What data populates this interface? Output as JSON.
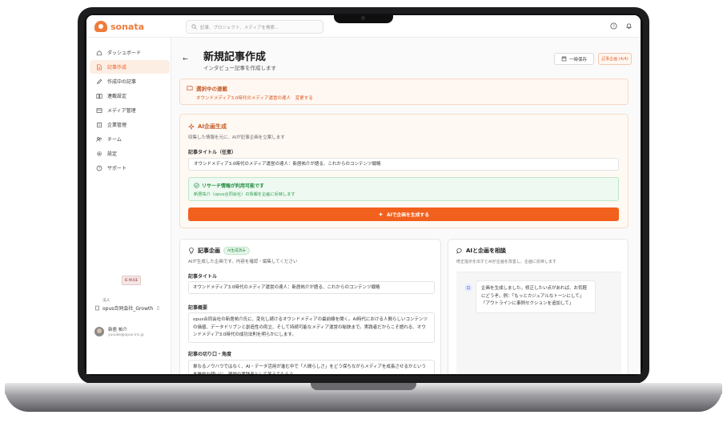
{
  "app": {
    "brand": "sonata"
  },
  "search": {
    "placeholder": "記事、プロジェクト、メディアを検索..."
  },
  "sidebar": {
    "items": [
      {
        "label": "ダッシュボード",
        "icon": "home-icon",
        "active": false
      },
      {
        "label": "記事作成",
        "icon": "document-icon",
        "active": true
      },
      {
        "label": "作成中の記事",
        "icon": "pencil-icon",
        "active": false
      },
      {
        "label": "連載設定",
        "icon": "book-icon",
        "active": false
      },
      {
        "label": "メディア管理",
        "icon": "media-icon",
        "active": false
      },
      {
        "label": "企業管理",
        "icon": "building-icon",
        "active": false
      },
      {
        "label": "チーム",
        "icon": "team-icon",
        "active": false
      },
      {
        "label": "設定",
        "icon": "gear-icon",
        "active": false
      },
      {
        "label": "サポート",
        "icon": "help-icon",
        "active": false
      }
    ],
    "promo_label": "IE MUSE",
    "org_label": "法人",
    "org_name": "opus合同会社_Growth",
    "user_name": "新居 祐介",
    "user_email": "yusuke@opus-inc.jp"
  },
  "header": {
    "title": "新規記事作成",
    "subtitle": "インタビュー記事を作成します",
    "save_label": "一時保存",
    "step_label": "記事企画 (4/4)"
  },
  "selected": {
    "title": "選択中の連載",
    "value": "オウンドメディア3.0時代のメディア運営の達人",
    "change_label": "変更する"
  },
  "ai_generate": {
    "title": "AI企画生成",
    "description": "収集した情報を元に、AIが記事企画を立案します",
    "title_label": "記事タイトル（任意）",
    "title_value": "オウンドメディア3.0時代のメディア運営の達人：新居祐介が語る、これからのコンテンツ戦略",
    "research_title": "リサーチ情報が利用可能です",
    "research_desc": "新居祐介（opus合同会社）の情報を企画に反映します",
    "button_label": "AIで企画を生成する"
  },
  "plan": {
    "title": "記事企画",
    "badge": "AI生成済み",
    "description": "AIが生成した企画です。内容を確認・編集してください",
    "title_label": "記事タイトル",
    "title_value": "オウンドメディア3.0時代のメディア運営の達人：新居祐介が語る、これからのコンテンツ戦略",
    "summary_label": "記事概要",
    "summary_value": "opus合同会社の新居祐介氏に、変化し続けるオウンドメディアの最前線を聞く。AI時代における人間らしいコンテンツの価値、データドリブンと創造性の両立、そして持続可能なメディア運営の秘訣まで。実践者だからこそ語れる、オウンドメディア3.0時代の成功法則を明らかにします。",
    "angle_label": "記事の切り口・角度",
    "angle_value": "単なるノウハウではなく、AI・データ活用が進む中で「人間らしさ」をどう保ちながらメディアを成長させるかという本質的な問いに、現場の実践者として答えてもらう。"
  },
  "chat": {
    "title": "AIと企画を相談",
    "description": "修正指示を出すとAIが企画を改善し、企画に反映します",
    "message": "企画を生成しました。修正したい点があれば、お気軽にどうぞ。例：「もっとカジュアルなトーンにして」「アウトラインに事例セクションを追加して」"
  },
  "colors": {
    "accent": "#f2601d",
    "brand": "#f07b3a",
    "success": "#1f8a3d"
  }
}
